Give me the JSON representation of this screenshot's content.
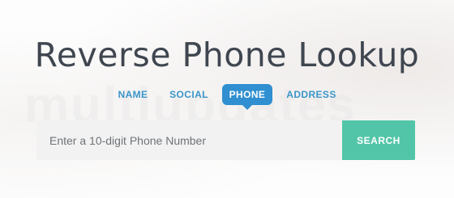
{
  "page": {
    "title": "Reverse Phone Lookup",
    "watermark": "multiupdates"
  },
  "tabs": [
    {
      "label": "NAME",
      "active": false
    },
    {
      "label": "SOCIAL",
      "active": false
    },
    {
      "label": "PHONE",
      "active": true
    },
    {
      "label": "ADDRESS",
      "active": false
    }
  ],
  "search": {
    "placeholder": "Enter a 10-digit Phone Number",
    "value": "",
    "button_label": "SEARCH"
  },
  "colors": {
    "title": "#3f4650",
    "tab_text": "#3b95c9",
    "tab_active_bg": "#2f8fd0",
    "input_bg": "#f2f2f2",
    "button_bg": "#52c5a8"
  }
}
